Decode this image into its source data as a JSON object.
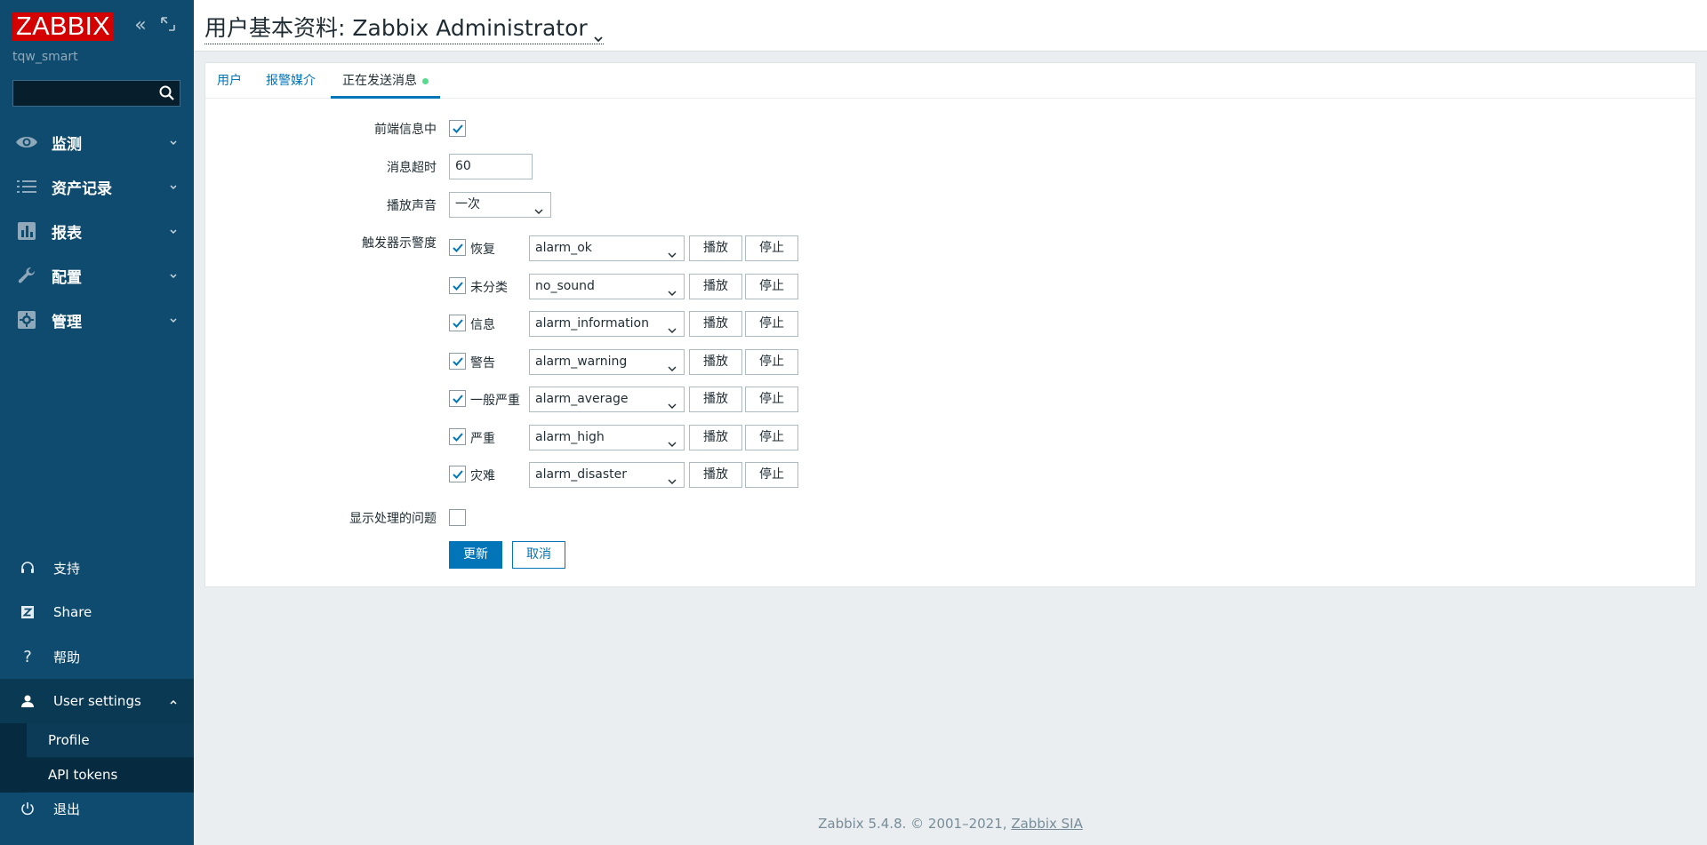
{
  "sidebar": {
    "logo": "ZABBIX",
    "server_name": "tqw_smart",
    "search": {
      "placeholder": "",
      "value": ""
    },
    "menu": [
      {
        "label": "监测",
        "icon": "eye-icon"
      },
      {
        "label": "资产记录",
        "icon": "list-icon"
      },
      {
        "label": "报表",
        "icon": "bar-chart-icon"
      },
      {
        "label": "配置",
        "icon": "wrench-icon"
      },
      {
        "label": "管理",
        "icon": "gear-icon"
      }
    ],
    "bottom": {
      "support": "支持",
      "share": "Share",
      "help": "帮助",
      "user_settings": "User settings",
      "sub_items": [
        "Profile",
        "API tokens"
      ],
      "logout": "退出"
    }
  },
  "header": {
    "title": "用户基本资料: Zabbix Administrator"
  },
  "tabs": [
    {
      "label": "用户"
    },
    {
      "label": "报警媒介"
    },
    {
      "label": "正在发送消息"
    }
  ],
  "form": {
    "frontend_messaging": {
      "label": "前端信息中",
      "checked": true
    },
    "message_timeout": {
      "label": "消息超时",
      "value": "60"
    },
    "play_sound": {
      "label": "播放声音",
      "value": "一次"
    },
    "trigger_severity_label": "触发器示警度",
    "severities": [
      {
        "label": "恢复",
        "checked": true,
        "sound": "alarm_ok"
      },
      {
        "label": "未分类",
        "checked": true,
        "sound": "no_sound"
      },
      {
        "label": "信息",
        "checked": true,
        "sound": "alarm_information"
      },
      {
        "label": "警告",
        "checked": true,
        "sound": "alarm_warning"
      },
      {
        "label": "一般严重",
        "checked": true,
        "sound": "alarm_average"
      },
      {
        "label": "严重",
        "checked": true,
        "sound": "alarm_high"
      },
      {
        "label": "灾难",
        "checked": true,
        "sound": "alarm_disaster"
      }
    ],
    "play_button": "播放",
    "stop_button": "停止",
    "show_suppressed": {
      "label": "显示处理的问题",
      "checked": false
    },
    "update_button": "更新",
    "cancel_button": "取消"
  },
  "footer": {
    "text": "Zabbix 5.4.8. © 2001–2021,",
    "link": "Zabbix SIA"
  },
  "colors": {
    "sidebar_bg": "#0f4b6e",
    "logo_red": "#d40000",
    "link_blue": "#0275b8",
    "status_green": "#59db8f"
  }
}
